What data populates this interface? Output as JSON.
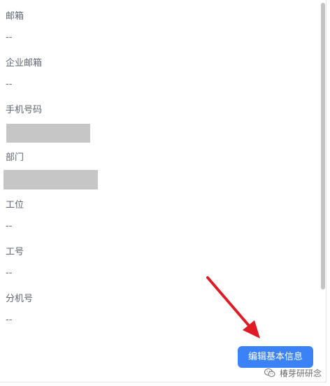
{
  "fields": [
    {
      "label": "邮箱",
      "value": "--"
    },
    {
      "label": "企业邮箱",
      "value": "--"
    },
    {
      "label": "手机号码",
      "value": ""
    },
    {
      "label": "部门",
      "value": ""
    },
    {
      "label": "工位",
      "value": "--"
    },
    {
      "label": "工号",
      "value": "--"
    },
    {
      "label": "分机号",
      "value": "--"
    }
  ],
  "actions": {
    "edit_label": "编辑基本信息"
  },
  "annotation": {
    "arrow_color": "#e01b24"
  },
  "watermark": {
    "text": "椿芽研研念",
    "icon": "wechat-icon"
  },
  "colors": {
    "accent": "#3b82f6",
    "label": "#606570",
    "value": "#6b6f78"
  }
}
